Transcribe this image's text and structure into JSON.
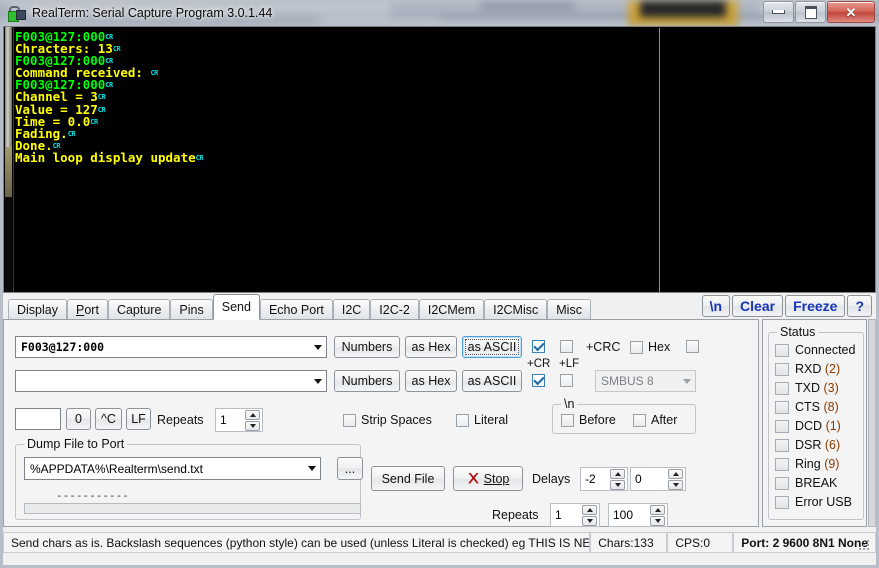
{
  "window": {
    "title": "RealTerm: Serial Capture Program 3.0.1.44",
    "icon": "realterm-lock-icon",
    "minimize_label": "",
    "maximize_label": "",
    "close_label": "✕"
  },
  "terminal": {
    "lines": [
      {
        "text": "F003@127:000",
        "color": "green",
        "cr": true
      },
      {
        "text": "Chracters: 13",
        "color": "yellow",
        "cr": true
      },
      {
        "text": "F003@127:000",
        "color": "green",
        "cr": true
      },
      {
        "text": "Command received: ",
        "color": "yellow",
        "cr": true
      },
      {
        "text": "F003@127:000",
        "color": "green",
        "cr": true
      },
      {
        "text": "Channel = 3",
        "color": "yellow",
        "cr": true
      },
      {
        "text": "Value = 127",
        "color": "yellow",
        "cr": true
      },
      {
        "text": "Time = 0.0",
        "color": "yellow",
        "cr": true
      },
      {
        "text": "Fading.",
        "color": "yellow",
        "cr": true
      },
      {
        "text": "Done.",
        "color": "yellow",
        "cr": true
      },
      {
        "text": "Main loop display update",
        "color": "yellow",
        "cr": true
      }
    ],
    "cr_glyph": "CR",
    "green_hex": "#00ff00",
    "yellow_hex": "#ffff00",
    "background_hex": "#000000"
  },
  "tabs": [
    {
      "label": "Display",
      "active": false
    },
    {
      "label": "Port",
      "active": false
    },
    {
      "label": "Capture",
      "active": false
    },
    {
      "label": "Pins",
      "active": false
    },
    {
      "label": "Send",
      "active": true
    },
    {
      "label": "Echo Port",
      "active": false
    },
    {
      "label": "I2C",
      "active": false
    },
    {
      "label": "I2C-2",
      "active": false
    },
    {
      "label": "I2CMem",
      "active": false
    },
    {
      "label": "I2CMisc",
      "active": false
    },
    {
      "label": "Misc",
      "active": false
    }
  ],
  "top_buttons": [
    {
      "label": "\\n"
    },
    {
      "label": "Clear"
    },
    {
      "label": "Freeze"
    },
    {
      "label": "?"
    }
  ],
  "top_button_color": "#1536b8",
  "send": {
    "row1": {
      "combo_value": "F003@127:000",
      "numbers_label": "Numbers",
      "as_hex_label": "as Hex",
      "as_ascii_label": "as ASCII",
      "cr_checked": true,
      "lf_checked": false
    },
    "row2": {
      "combo_value": "",
      "numbers_label": "Numbers",
      "as_hex_label": "as Hex",
      "as_ascii_label": "as ASCII",
      "cr_checked": true,
      "lf_checked": false,
      "smbus_value": "SMBUS 8"
    },
    "cr_label": "+CR",
    "lf_label": "+LF",
    "crc_label": "+CRC",
    "crc_checked": false,
    "hex_label": "Hex",
    "hex_checked": false,
    "extra_checked": false,
    "row3": {
      "text_value": "",
      "zero_label": "0",
      "ctrlc_label": "^C",
      "lf_btn_label": "LF",
      "repeats_label": "Repeats",
      "repeats_value": "1"
    },
    "strip_spaces_label": "Strip Spaces",
    "strip_spaces_checked": false,
    "literal_label": "Literal",
    "literal_checked": false,
    "newline_group_caption": "\\n",
    "before_label": "Before",
    "before_checked": false,
    "after_label": "After",
    "after_checked": false,
    "dump": {
      "group_caption": "Dump File to Port",
      "path_value": "%APPDATA%\\Realterm\\send.txt",
      "browse_label": "...",
      "send_file_label": "Send File",
      "stop_label": "Stop",
      "stop_icon": "red-x-icon",
      "delays_label": "Delays",
      "delay1_value": "-2",
      "delay2_value": "0",
      "repeats_label": "Repeats",
      "repeats1_value": "1",
      "repeats2_value": "100",
      "progress_dashes": "-----------"
    }
  },
  "status_panel": {
    "caption": "Status",
    "items": [
      {
        "label": "Connected",
        "num": ""
      },
      {
        "label": "RXD",
        "num": "(2)"
      },
      {
        "label": "TXD",
        "num": "(3)"
      },
      {
        "label": "CTS",
        "num": "(8)"
      },
      {
        "label": "DCD",
        "num": "(1)"
      },
      {
        "label": "DSR",
        "num": "(6)"
      },
      {
        "label": "Ring",
        "num": "(9)"
      },
      {
        "label": "BREAK",
        "num": ""
      },
      {
        "label": "Error  USB",
        "num": ""
      }
    ]
  },
  "statusbar": {
    "message": "Send chars as is. Backslash sequences (python style) can be used  (unless Literal is checked) eg THIS IS NEWLINE",
    "chars": "Chars:133",
    "cps": "CPS:0",
    "port": "Port: 2  9600 8N1 None"
  }
}
